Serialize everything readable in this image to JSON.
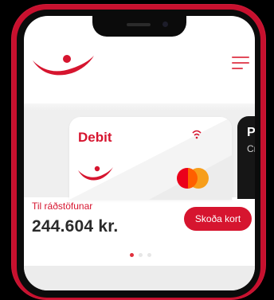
{
  "card": {
    "title": "Debit",
    "network": "Mastercard"
  },
  "next_card": {
    "title": "Pr",
    "subtitle": "Cr"
  },
  "balance": {
    "label": "Til ráðstöfunar",
    "value": "244.604 kr."
  },
  "buttons": {
    "view_card": "Skoða kort"
  },
  "carousel": {
    "total_pages": 3,
    "active_index": 0
  },
  "colors": {
    "brand_red": "#d6152f",
    "frame_red": "#c8102e",
    "dot_active": "#e0303d",
    "dot_inactive": "#e6e6e6"
  },
  "icons": {
    "logo": "brand-logo",
    "menu": "hamburger-menu-icon",
    "contactless": "contactless-icon"
  }
}
